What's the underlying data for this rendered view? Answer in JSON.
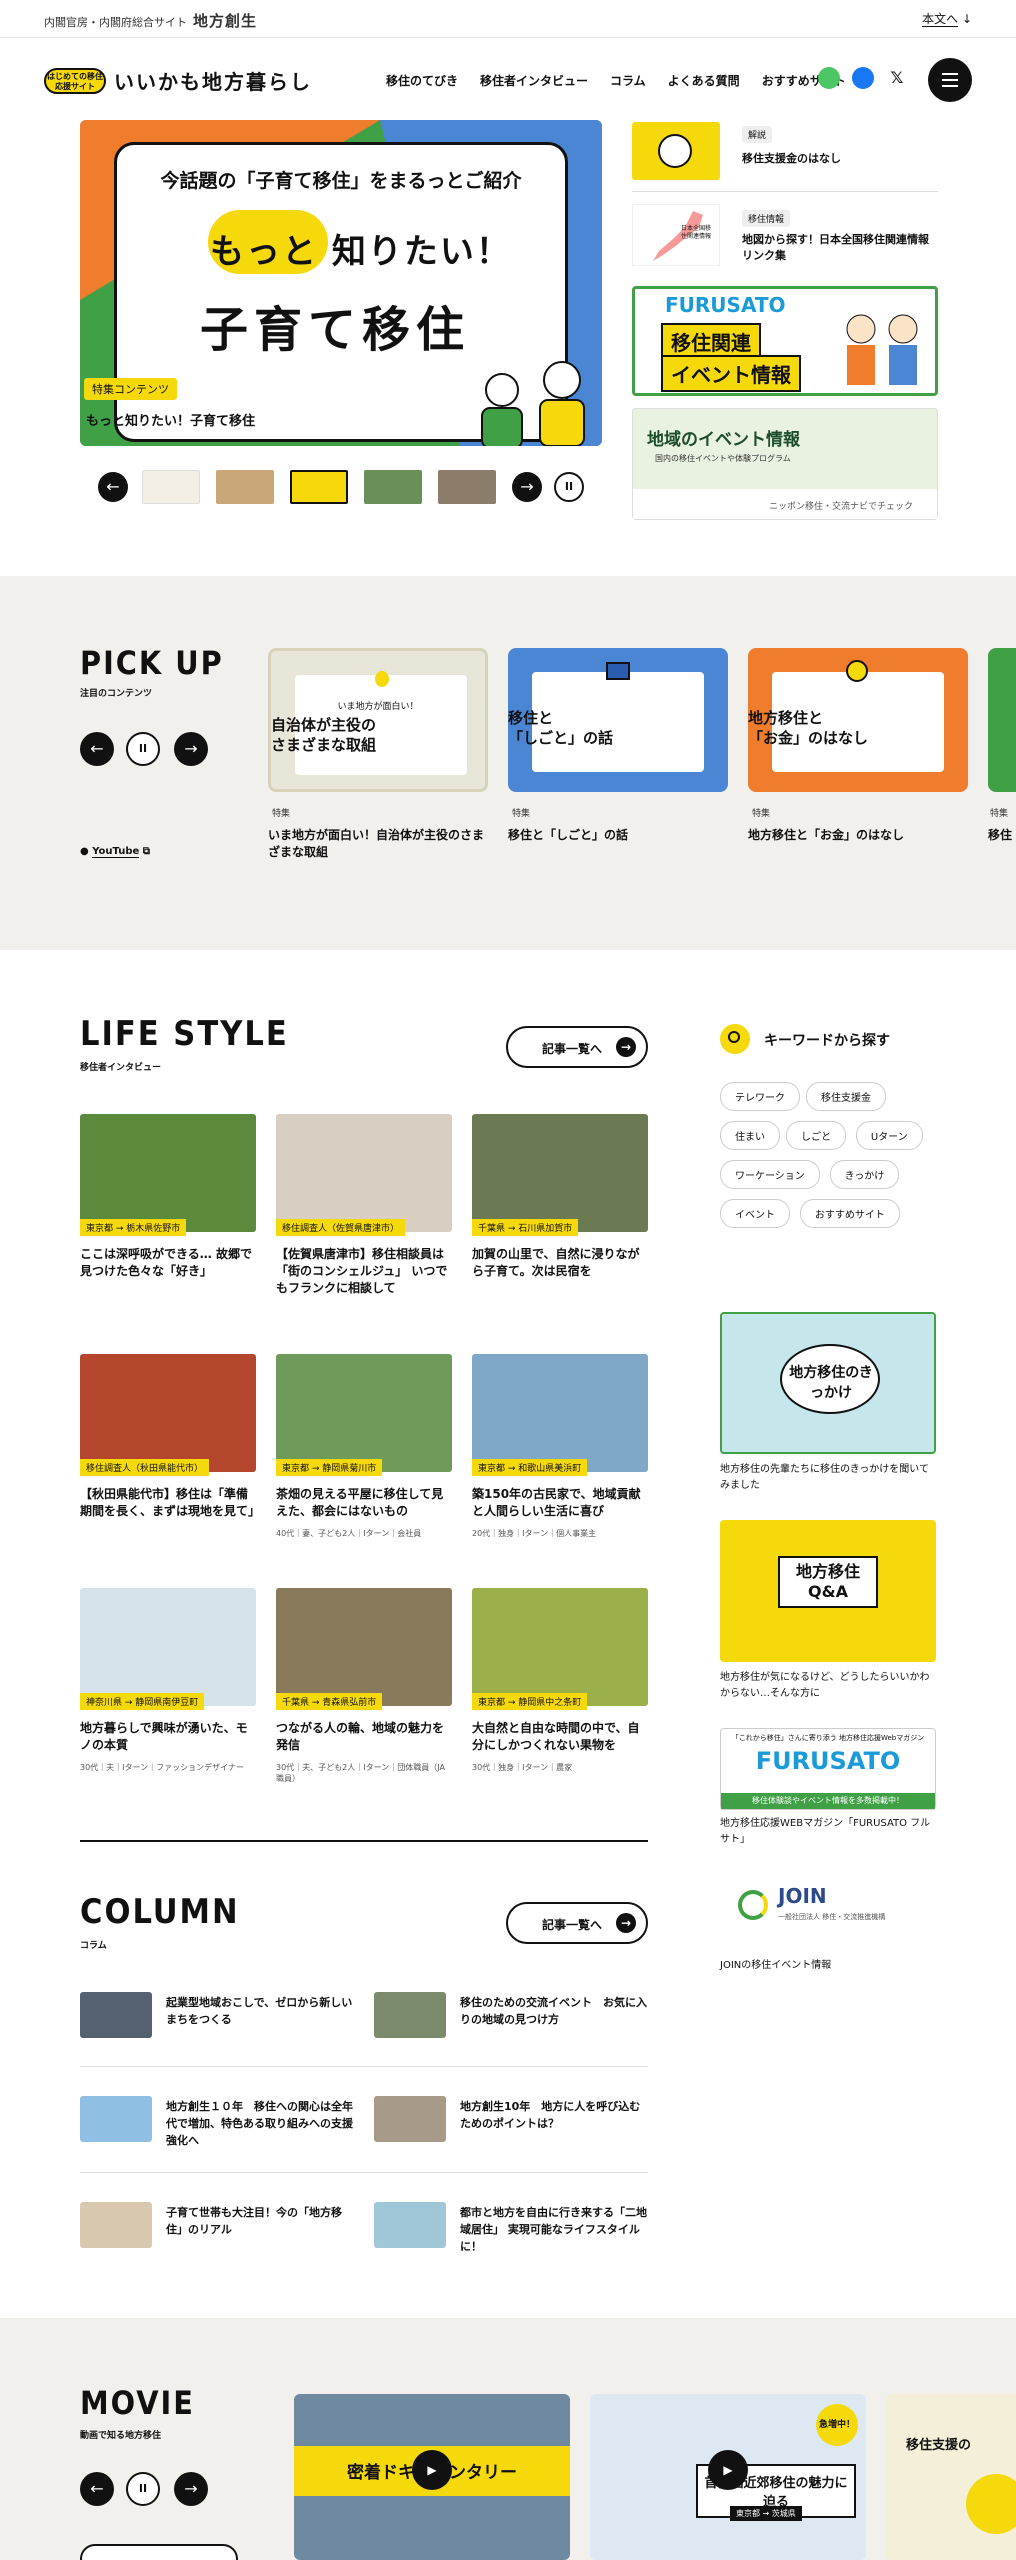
{
  "topbar": {
    "org": "内閣官房・内閣府総合サイト",
    "brand": "地方創生",
    "skip_link": "本文へ",
    "skip_icon": "arrow-down-icon"
  },
  "header": {
    "logo_badge": "はじめての移住応援サイト",
    "logo_text": "いいかも地方暮らし",
    "nav": [
      "移住のてびき",
      "移住者インタビュー",
      "コラム",
      "よくある質問",
      "おすすめサイト"
    ],
    "social": [
      "line-icon",
      "facebook-icon",
      "x-icon"
    ],
    "menu_icon": "hamburger-icon"
  },
  "hero": {
    "line1": "今話題の「子育て移住」をまるっとご紹介",
    "line2": "もっと 知りたい！",
    "line3": "子育て移住",
    "tag": "特集コンテンツ",
    "caption": "もっと知りたい！子育て移住",
    "colors": {
      "green": "#3fa046",
      "orange": "#ef7d2d",
      "blue": "#4a86d4",
      "yellow": "#f5d90a"
    }
  },
  "side": {
    "items": [
      {
        "badge": "解説",
        "title": "移住支援金のはなし"
      },
      {
        "badge": "移住情報",
        "title": "地図から探す！日本全国移住関連情報リンク集",
        "map_label": "日本全国移住関連情報"
      }
    ],
    "banner1": {
      "brand": "FURUSATO",
      "line1": "移住関連",
      "line2": "イベント情報"
    },
    "banner2": {
      "title": "地域のイベント情報",
      "sub": "国内の移住イベントや体験プログラム",
      "foot": "ニッポン移住・交流ナビでチェック"
    }
  },
  "pickup": {
    "title": "PICK UP",
    "subtitle": "注目のコンテンツ",
    "youtube": "YouTube",
    "cards": [
      {
        "top": "いま地方が面白い！",
        "title": "自治体が主役の\nさまざまな取組",
        "tag": "特集",
        "caption": "いま地方が面白い！自治体が主役のさまざまな取組"
      },
      {
        "title": "移住と\n「しごと」の話",
        "tag": "特集",
        "caption": "移住と「しごと」の話"
      },
      {
        "title": "地方移住と\n「お金」のはなし",
        "tag": "特集",
        "caption": "地方移住と「お金」のはなし"
      },
      {
        "tag": "特集",
        "caption": "移住"
      }
    ]
  },
  "lifestyle": {
    "title": "LIFE STYLE",
    "subtitle": "移住者インタビュー",
    "more": "記事一覧へ",
    "cards": [
      {
        "loc": "東京都 → 栃木県佐野市",
        "title": "ここは深呼吸ができる… 故郷で見つけた色々な「好き」",
        "meta": ""
      },
      {
        "loc": "移住調査人（佐賀県唐津市）",
        "title": "【佐賀県唐津市】移住相談員は「街のコンシェルジュ」 いつでもフランクに相談して",
        "meta": ""
      },
      {
        "loc": "千葉県 → 石川県加賀市",
        "title": "加賀の山里で、自然に浸りながら子育て。次は民宿を",
        "meta": ""
      },
      {
        "loc": "移住調査人（秋田県能代市）",
        "title": "【秋田県能代市】移住は「準備期間を長く、まずは現地を見て」",
        "meta": ""
      },
      {
        "loc": "東京都 → 静岡県菊川市",
        "title": "茶畑の見える平屋に移住して見えた、都会にはないもの",
        "meta": "40代｜妻、子ども2人｜Iターン｜会社員"
      },
      {
        "loc": "東京都 → 和歌山県美浜町",
        "title": "築150年の古民家で、地域貢献と人間らしい生活に喜び",
        "meta": "20代｜独身｜Iターン｜個人事業主"
      },
      {
        "loc": "神奈川県 → 静岡県南伊豆町",
        "title": "地方暮らしで興味が湧いた、モノの本質",
        "meta": "30代｜夫｜Iターン｜ファッションデザイナー"
      },
      {
        "loc": "千葉県 → 青森県弘前市",
        "title": "つながる人の輪、地域の魅力を発信",
        "meta": "30代｜夫、子ども2人｜Iターン｜団体職員（JA職員）"
      },
      {
        "loc": "東京都 → 静岡県中之条町",
        "title": "大自然と自由な時間の中で、自分にしかつくれない果物を",
        "meta": "30代｜独身｜Iターン｜農家"
      }
    ]
  },
  "keywords": {
    "title": "キーワードから探す",
    "icon": "search-icon",
    "tags": [
      "テレワーク",
      "移住支援金",
      "住まい",
      "しごと",
      "Uターン",
      "ワーケーション",
      "きっかけ",
      "イベント",
      "おすすめサイト"
    ]
  },
  "banners": [
    {
      "title": "地方移住のきっかけ",
      "caption": "地方移住の先輩たちに移住のきっかけを聞いてみました"
    },
    {
      "title": "地方移住\nQ&A",
      "caption": "地方移住が気になるけど、どうしたらいいかわからない…そんな方に"
    },
    {
      "brand": "FURUSATO",
      "top": "「これから移住」さんに寄り添う 地方移住応援Webマガジン",
      "foot": "移住体験談やイベント情報を多数掲載中！",
      "caption": "地方移住応援WEBマガジン「FURUSATO フルサト」"
    },
    {
      "brand": "JOIN",
      "sub": "一般社団法人 移住・交流推進機構",
      "caption": "JOINの移住イベント情報"
    }
  ],
  "column": {
    "title": "COLUMN",
    "subtitle": "コラム",
    "more": "記事一覧へ",
    "items": [
      "起業型地域おこしで、ゼロから新しいまちをつくる",
      "移住のための交流イベント　お気に入りの地域の見つけ方",
      "地方創生１０年　移住への関心は全年代で増加、特色ある取り組みへの支援強化へ",
      "地方創生10年　地方に人を呼び込むためのポイントは？",
      "子育て世帯も大注目！今の「地方移住」のリアル",
      "都市と地方を自由に行き来する「二地域居住」 実現可能なライフスタイルに！"
    ]
  },
  "movie": {
    "title": "MOVIE",
    "subtitle": "動画で知る地方移住",
    "cards": [
      {
        "label": "密着ドキュメンタリー"
      },
      {
        "badge": "急増中！",
        "label": "首都圏近郊移住の魅力に迫る",
        "route": "東京都 → 茨城県"
      },
      {
        "label": "移住支援の"
      }
    ]
  }
}
